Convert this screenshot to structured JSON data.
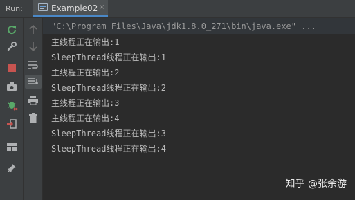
{
  "run_panel": {
    "label": "Run:",
    "tab": {
      "label": "Example02",
      "close": "×"
    }
  },
  "console": {
    "command": "\"C:\\Program Files\\Java\\jdk1.8.0_271\\bin\\java.exe\" ...",
    "lines": [
      "主线程正在输出:1",
      "SleepThread线程正在输出:1",
      "主线程正在输出:2",
      "SleepThread线程正在输出:2",
      "主线程正在输出:3",
      "主线程正在输出:4",
      "SleepThread线程正在输出:3",
      "SleepThread线程正在输出:4"
    ]
  },
  "watermark": "知乎 @张余游",
  "toolbar_left": [
    "rerun-icon",
    "wrench-icon",
    "stop-icon",
    "camera-icon",
    "debug-bug-icon",
    "login-icon",
    "layout-icon",
    "pin-icon"
  ],
  "toolbar_right": [
    "arrow-up-icon",
    "arrow-down-icon",
    "soft-wrap-icon",
    "scroll-to-end-icon",
    "print-icon",
    "trash-icon"
  ],
  "colors": {
    "background": "#2b2b2b",
    "panel": "#3c3f41",
    "accent": "#4a88c7",
    "text": "#bbbbbb"
  }
}
